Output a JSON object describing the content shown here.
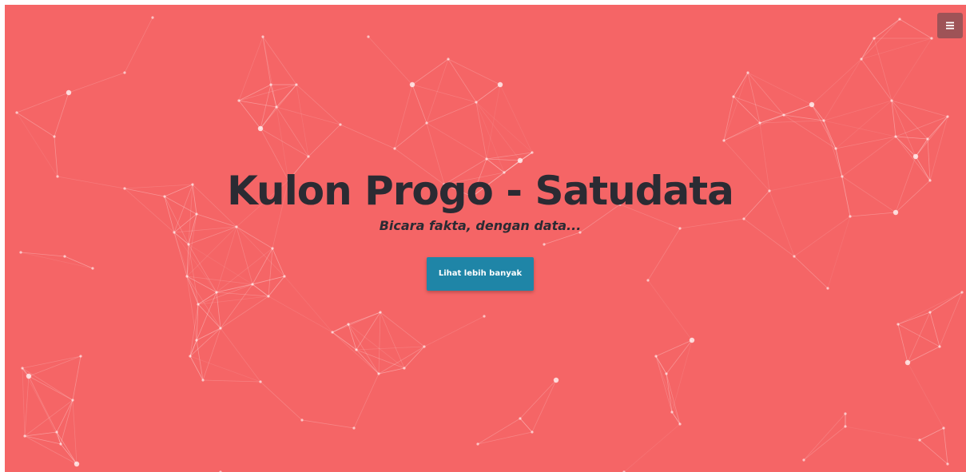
{
  "hero": {
    "title": "Kulon Progo - Satudata",
    "tagline": "Bicara fakta, dengan data...",
    "cta_label": "Lihat lebih banyak",
    "background_icon": "particle-network"
  },
  "menu": {
    "icon": "hamburger-icon"
  },
  "colors": {
    "background": "#f56566",
    "title_text": "#2b2b33",
    "button": "#1f85a7",
    "menu_button": "#9e5357",
    "network": "#ffffff"
  }
}
